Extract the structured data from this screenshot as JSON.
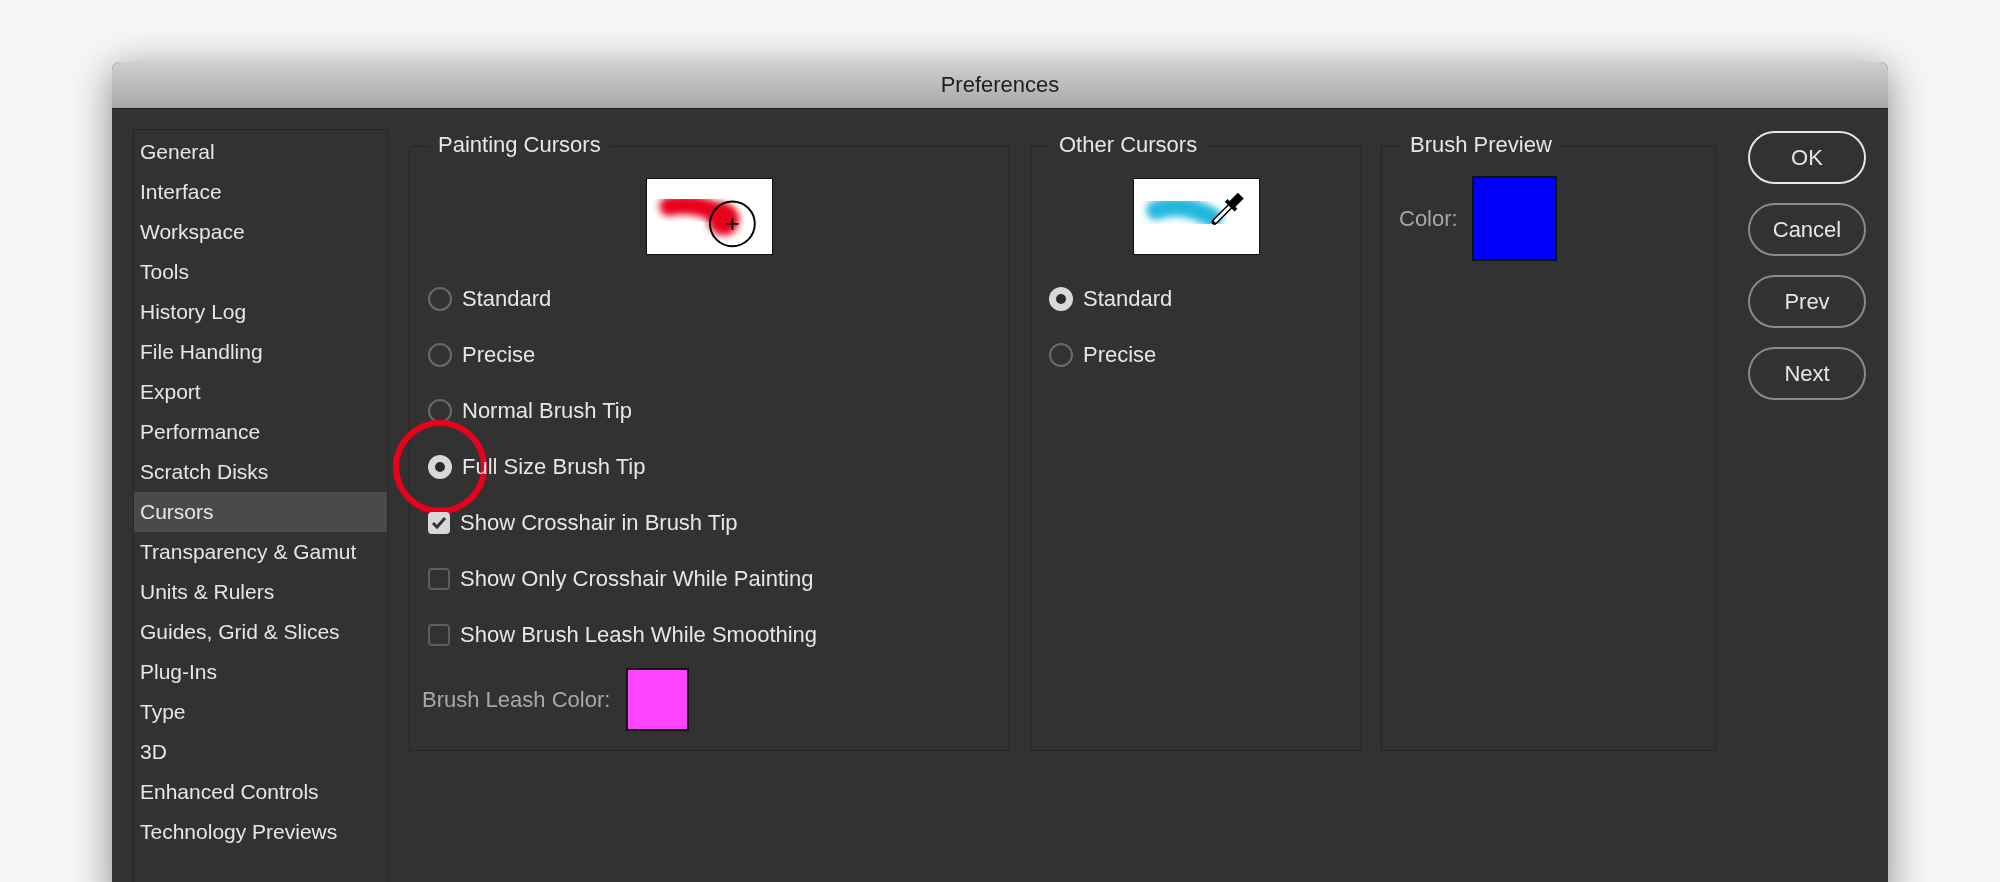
{
  "window": {
    "title": "Preferences"
  },
  "sidebar": {
    "items": [
      {
        "label": "General",
        "selected": false
      },
      {
        "label": "Interface",
        "selected": false
      },
      {
        "label": "Workspace",
        "selected": false
      },
      {
        "label": "Tools",
        "selected": false
      },
      {
        "label": "History Log",
        "selected": false
      },
      {
        "label": "File Handling",
        "selected": false
      },
      {
        "label": "Export",
        "selected": false
      },
      {
        "label": "Performance",
        "selected": false
      },
      {
        "label": "Scratch Disks",
        "selected": false
      },
      {
        "label": "Cursors",
        "selected": true
      },
      {
        "label": "Transparency & Gamut",
        "selected": false
      },
      {
        "label": "Units & Rulers",
        "selected": false
      },
      {
        "label": "Guides, Grid & Slices",
        "selected": false
      },
      {
        "label": "Plug-Ins",
        "selected": false
      },
      {
        "label": "Type",
        "selected": false
      },
      {
        "label": "3D",
        "selected": false
      },
      {
        "label": "Enhanced Controls",
        "selected": false
      },
      {
        "label": "Technology Previews",
        "selected": false
      }
    ]
  },
  "painting_cursors": {
    "title": "Painting Cursors",
    "options": [
      {
        "kind": "radio",
        "label": "Standard",
        "selected": false,
        "highlighted": false
      },
      {
        "kind": "radio",
        "label": "Precise",
        "selected": false,
        "highlighted": false
      },
      {
        "kind": "radio",
        "label": "Normal Brush Tip",
        "selected": false,
        "highlighted": false
      },
      {
        "kind": "radio",
        "label": "Full Size Brush Tip",
        "selected": true,
        "highlighted": true
      },
      {
        "kind": "checkbox",
        "label": "Show Crosshair in Brush Tip",
        "checked": true,
        "highlighted": false
      },
      {
        "kind": "checkbox",
        "label": "Show Only Crosshair While Painting",
        "checked": false,
        "highlighted": false
      },
      {
        "kind": "checkbox",
        "label": "Show Brush Leash While Smoothing",
        "checked": false,
        "highlighted": false
      }
    ],
    "leash_color": {
      "label": "Brush Leash Color:",
      "color": "#ff44ff"
    }
  },
  "other_cursors": {
    "title": "Other Cursors",
    "options": [
      {
        "label": "Standard",
        "selected": true
      },
      {
        "label": "Precise",
        "selected": false
      }
    ]
  },
  "brush_preview": {
    "title": "Brush Preview",
    "color_label": "Color:",
    "color": "#0000ff"
  },
  "buttons": [
    {
      "label": "OK",
      "default": true
    },
    {
      "label": "Cancel",
      "default": false
    },
    {
      "label": "Prev",
      "default": false
    },
    {
      "label": "Next",
      "default": false
    }
  ]
}
